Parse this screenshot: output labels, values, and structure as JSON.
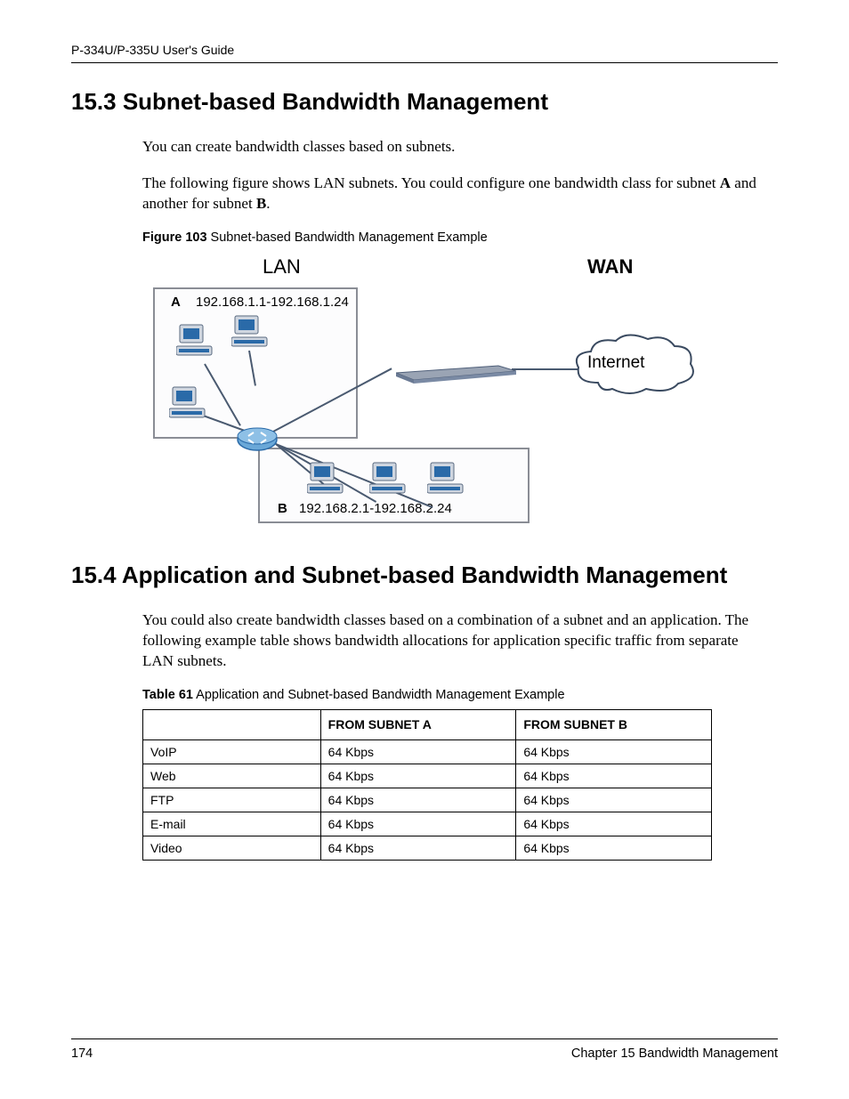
{
  "header": {
    "running": "P-334U/P-335U User's Guide"
  },
  "section153": {
    "heading": "15.3  Subnet-based Bandwidth Management",
    "p1": "You can create bandwidth classes based on subnets.",
    "p2_a": "The following figure shows LAN subnets. You could configure one bandwidth class for subnet ",
    "p2_b": "A",
    "p2_c": " and another for subnet ",
    "p2_d": "B",
    "p2_e": ".",
    "fig_caption_bold": "Figure 103",
    "fig_caption_rest": "   Subnet-based Bandwidth Management Example",
    "fig": {
      "lan": "LAN",
      "wan": "WAN",
      "subnet_a_letter": "A",
      "subnet_a_ip": "192.168.1.1-192.168.1.24",
      "subnet_b_letter": "B",
      "subnet_b_ip": "192.168.2.1-192.168.2.24",
      "internet": "Internet"
    }
  },
  "section154": {
    "heading": "15.4  Application and Subnet-based Bandwidth Management",
    "p1": "You could also create bandwidth classes based on a combination of a subnet and an application. The following example table shows bandwidth allocations for application specific traffic from separate LAN subnets.",
    "table_caption_bold": "Table 61",
    "table_caption_rest": "   Application and Subnet-based Bandwidth Management Example",
    "table": {
      "headers": [
        "",
        "FROM SUBNET A",
        "FROM SUBNET B"
      ],
      "rows": [
        [
          "VoIP",
          "64 Kbps",
          "64 Kbps"
        ],
        [
          "Web",
          "64 Kbps",
          "64 Kbps"
        ],
        [
          "FTP",
          "64 Kbps",
          "64 Kbps"
        ],
        [
          "E-mail",
          "64 Kbps",
          "64 Kbps"
        ],
        [
          "Video",
          "64 Kbps",
          "64 Kbps"
        ]
      ]
    }
  },
  "footer": {
    "page": "174",
    "chapter": "Chapter 15 Bandwidth Management"
  }
}
